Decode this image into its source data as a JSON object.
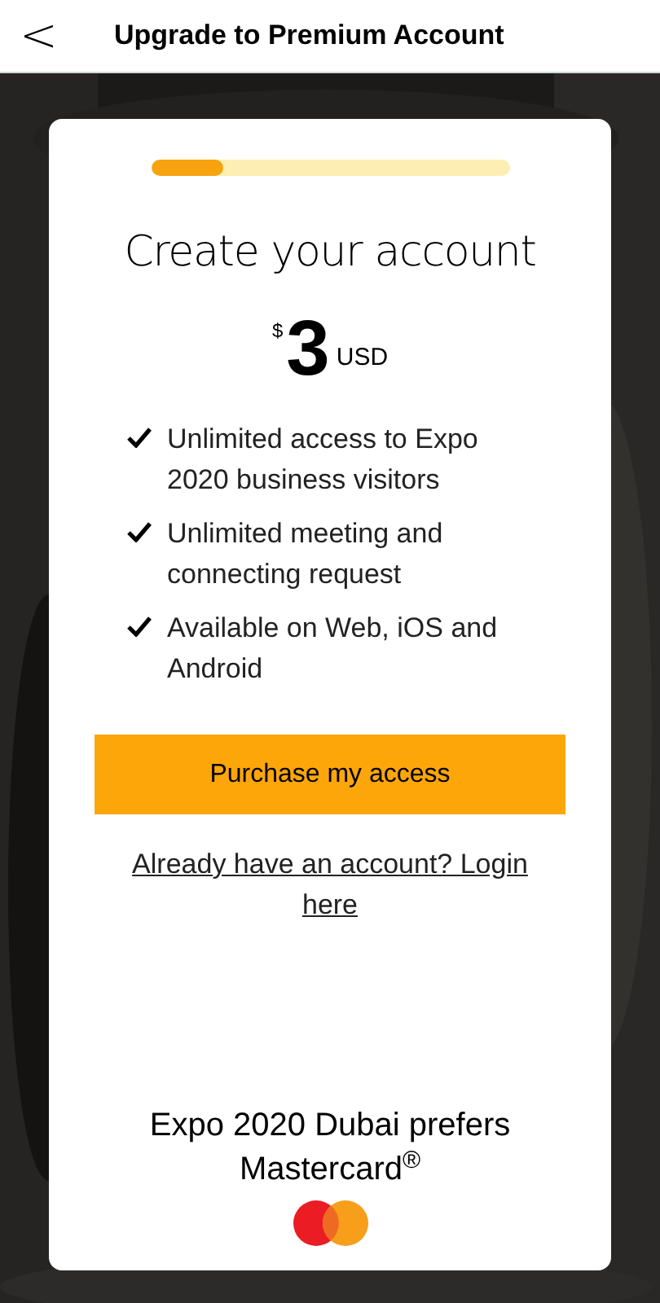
{
  "header": {
    "back": "<",
    "title": "Upgrade to Premium Account"
  },
  "progress": {
    "level": 0.2
  },
  "card": {
    "heading": "Create your account",
    "price": {
      "currency_symbol": "$",
      "amount": "3",
      "currency": "USD"
    },
    "features": [
      {
        "text": "Unlimited access to Expo 2020 business visitors"
      },
      {
        "text": "Unlimited meeting and connecting request"
      },
      {
        "text": "Available on Web, iOS and Android"
      }
    ],
    "purchase_button": "Purchase my access",
    "login_link": "Already have an account? Login here",
    "sponsor": "Expo 2020 Dubai prefers Mastercard$^{®}$"
  }
}
